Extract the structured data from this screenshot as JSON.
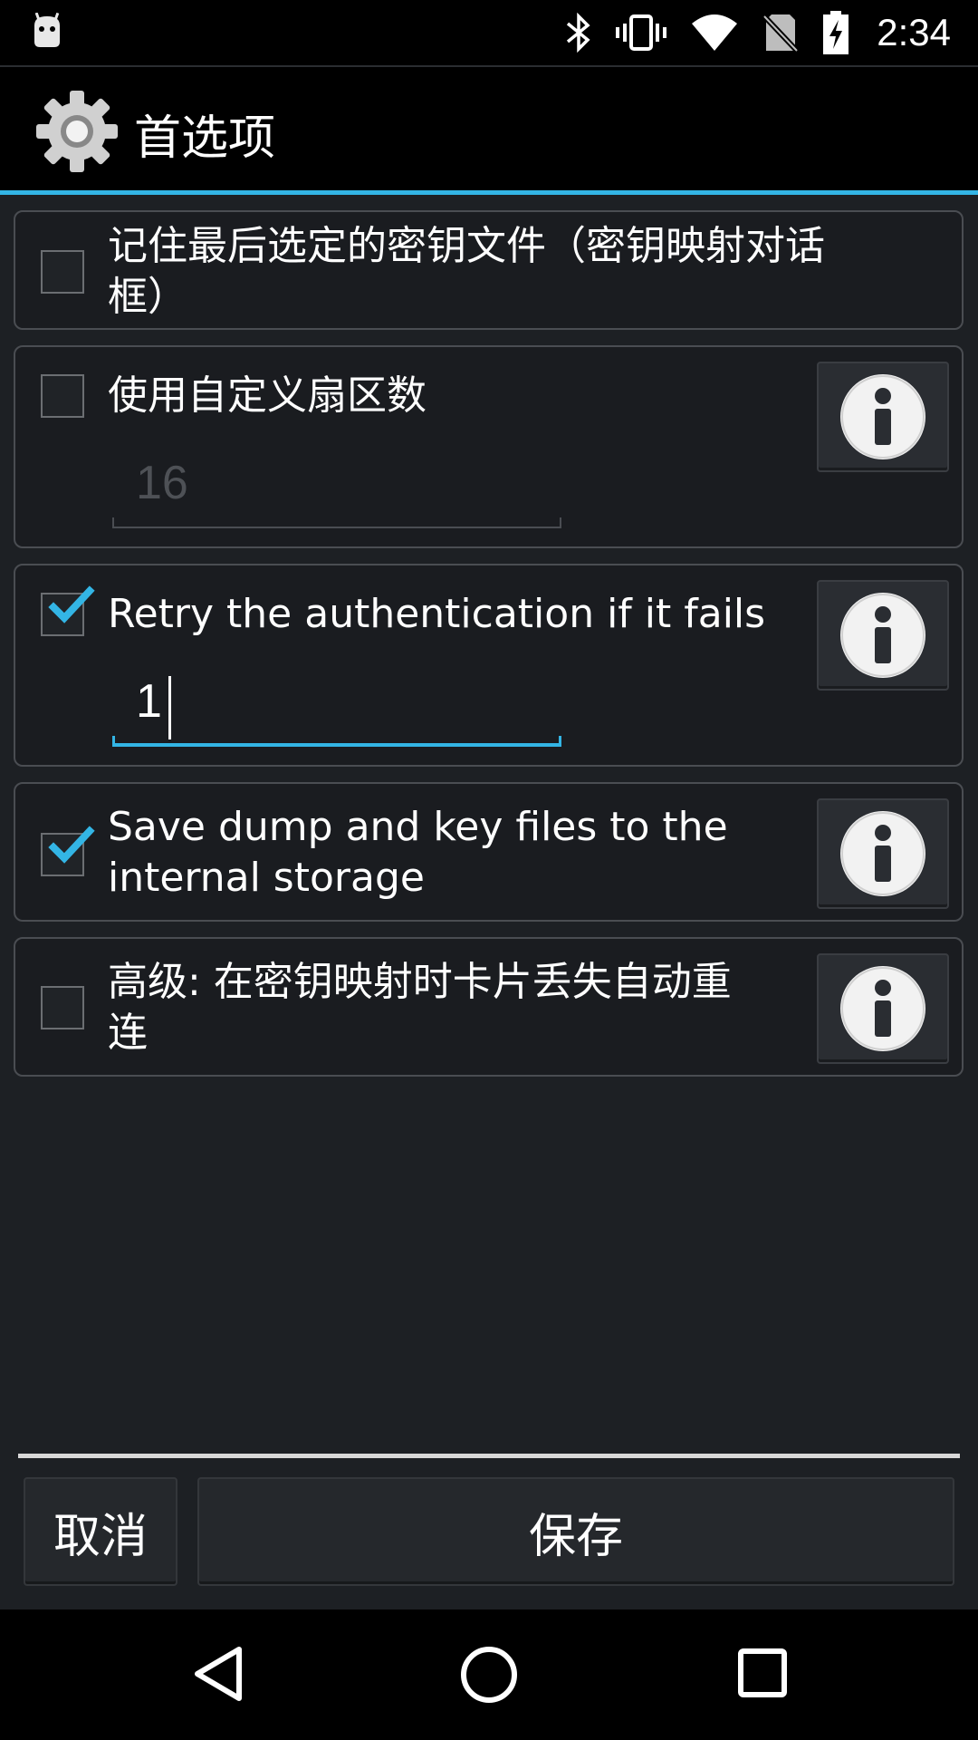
{
  "status_bar": {
    "time": "2:34",
    "icons": [
      "android-icon",
      "bluetooth-icon",
      "vibrate-icon",
      "wifi-icon",
      "no-sim-icon",
      "battery-charging-icon"
    ]
  },
  "title_bar": {
    "title": "首选项",
    "icon": "gear-icon"
  },
  "preferences": [
    {
      "label": "记住最后选定的密钥文件（密钥映射对话框）",
      "label_lines": [
        "记住最后选定的密钥文件（密钥映射对话",
        "框）"
      ],
      "checked": false
    },
    {
      "label": "使用自定义扇区数",
      "checked": false,
      "value": "16",
      "field_enabled": false
    },
    {
      "label": "Retry the authentication if it fails",
      "checked": true,
      "value": "1",
      "field_enabled": true
    },
    {
      "label": "Save dump and key files to the internal storage",
      "label_lines": [
        "Save dump and key files to the",
        "internal storage"
      ],
      "checked": true
    },
    {
      "label": "高级: 在密钥映射时卡片丢失自动重连",
      "label_lines": [
        "高级: 在密钥映射时卡片丢失自动重",
        "连"
      ],
      "checked": false
    }
  ],
  "buttons": {
    "cancel": "取消",
    "save": "保存"
  },
  "colors": {
    "accent": "#33b5e5",
    "background": "#1d2024"
  },
  "nav_bar": {
    "icons": [
      "back-icon",
      "home-icon",
      "recents-icon"
    ]
  }
}
